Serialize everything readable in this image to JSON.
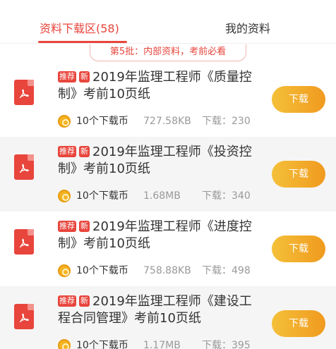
{
  "tabs": {
    "downloads_label": "资料下载区(58)",
    "mine_label": "我的资料"
  },
  "batch_notice": "第5批：内部资料，考前必看",
  "colors": {
    "accent": "#e8453c",
    "button": "#f0a42a",
    "muted": "#999999"
  },
  "items": [
    {
      "icon": "pdf-icon",
      "tag_recommend": "推荐",
      "tag_new": "新",
      "title": "2019年监理工程师《质量控制》考前10页纸",
      "cost": "10个下载币",
      "size": "727.58KB",
      "downloads": "下载：230",
      "button": "下载"
    },
    {
      "icon": "pdf-icon",
      "tag_recommend": "推荐",
      "tag_new": "新",
      "title": "2019年监理工程师《投资控制》考前10页纸",
      "cost": "10个下载币",
      "size": "1.68MB",
      "downloads": "下载：340",
      "button": "下载"
    },
    {
      "icon": "pdf-icon",
      "tag_recommend": "推荐",
      "tag_new": "新",
      "title": "2019年监理工程师《进度控制》考前10页纸",
      "cost": "10个下载币",
      "size": "758.88KB",
      "downloads": "下载：498",
      "button": "下载"
    },
    {
      "icon": "pdf-icon",
      "tag_recommend": "推荐",
      "tag_new": "新",
      "title": "2019年监理工程师《建设工程合同管理》考前10页纸",
      "cost": "10个下载币",
      "size": "1.17MB",
      "downloads": "下载：395",
      "button": "下载"
    }
  ]
}
